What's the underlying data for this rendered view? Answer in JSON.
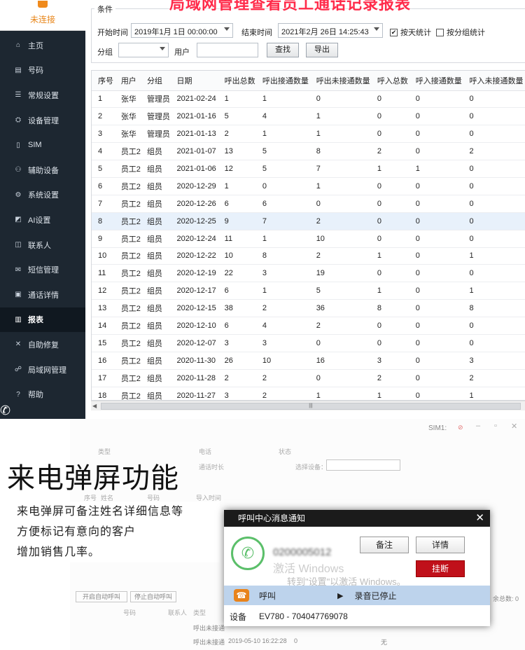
{
  "sidebar": {
    "status": "未连接",
    "items": [
      {
        "label": "主页",
        "icon": "home-icon"
      },
      {
        "label": "号码",
        "icon": "number-icon"
      },
      {
        "label": "常规设置",
        "icon": "settings-icon"
      },
      {
        "label": "设备管理",
        "icon": "device-icon"
      },
      {
        "label": "SIM",
        "icon": "sim-icon"
      },
      {
        "label": "辅助设备",
        "icon": "aux-device-icon"
      },
      {
        "label": "系统设置",
        "icon": "system-icon"
      },
      {
        "label": "AI设置",
        "icon": "ai-icon"
      },
      {
        "label": "联系人",
        "icon": "contacts-icon"
      },
      {
        "label": "短信管理",
        "icon": "sms-icon"
      },
      {
        "label": "通话详情",
        "icon": "call-detail-icon"
      },
      {
        "label": "报表",
        "icon": "report-icon"
      },
      {
        "label": "自助修复",
        "icon": "repair-icon"
      },
      {
        "label": "局域网管理",
        "icon": "lan-icon"
      },
      {
        "label": "帮助",
        "icon": "help-icon"
      }
    ],
    "active": "报表"
  },
  "banner": "局域网管理查看员工通话记录报表",
  "filters": {
    "legend": "条件",
    "start_label": "开始时间",
    "start_value": "2019年1月 1日 00:00:00",
    "end_label": "结束时间",
    "end_value": "2021年2月 26日 14:25:43",
    "by_day_label": "按天统计",
    "by_day_checked": true,
    "by_group_label": "按分组统计",
    "by_group_checked": false,
    "group_label": "分组",
    "group_value": "",
    "user_label": "用户",
    "user_value": "",
    "search_button": "查找",
    "export_button": "导出"
  },
  "table": {
    "columns": [
      "序号",
      "用户",
      "分组",
      "日期",
      "呼出总数",
      "呼出接通数量",
      "呼出未接通数量",
      "呼入总数",
      "呼入接通数量",
      "呼入未接通数量"
    ],
    "rows": [
      [
        "1",
        "张华",
        "管理员",
        "2021-02-24",
        "1",
        "1",
        "0",
        "0",
        "0",
        "0"
      ],
      [
        "2",
        "张华",
        "管理员",
        "2021-01-16",
        "5",
        "4",
        "1",
        "0",
        "0",
        "0"
      ],
      [
        "3",
        "张华",
        "管理员",
        "2021-01-13",
        "2",
        "1",
        "1",
        "0",
        "0",
        "0"
      ],
      [
        "4",
        "员工2",
        "组员",
        "2021-01-07",
        "13",
        "5",
        "8",
        "2",
        "0",
        "2"
      ],
      [
        "5",
        "员工2",
        "组员",
        "2021-01-06",
        "12",
        "5",
        "7",
        "1",
        "1",
        "0"
      ],
      [
        "6",
        "员工2",
        "组员",
        "2020-12-29",
        "1",
        "0",
        "1",
        "0",
        "0",
        "0"
      ],
      [
        "7",
        "员工2",
        "组员",
        "2020-12-26",
        "6",
        "6",
        "0",
        "0",
        "0",
        "0"
      ],
      [
        "8",
        "员工2",
        "组员",
        "2020-12-25",
        "9",
        "7",
        "2",
        "0",
        "0",
        "0"
      ],
      [
        "9",
        "员工2",
        "组员",
        "2020-12-24",
        "11",
        "1",
        "10",
        "0",
        "0",
        "0"
      ],
      [
        "10",
        "员工2",
        "组员",
        "2020-12-22",
        "10",
        "8",
        "2",
        "1",
        "0",
        "1"
      ],
      [
        "11",
        "员工2",
        "组员",
        "2020-12-19",
        "22",
        "3",
        "19",
        "0",
        "0",
        "0"
      ],
      [
        "12",
        "员工2",
        "组员",
        "2020-12-17",
        "6",
        "1",
        "5",
        "1",
        "0",
        "1"
      ],
      [
        "13",
        "员工2",
        "组员",
        "2020-12-15",
        "38",
        "2",
        "36",
        "8",
        "0",
        "8"
      ],
      [
        "14",
        "员工2",
        "组员",
        "2020-12-10",
        "6",
        "4",
        "2",
        "0",
        "0",
        "0"
      ],
      [
        "15",
        "员工2",
        "组员",
        "2020-12-07",
        "3",
        "3",
        "0",
        "0",
        "0",
        "0"
      ],
      [
        "16",
        "员工2",
        "组员",
        "2020-11-30",
        "26",
        "10",
        "16",
        "3",
        "0",
        "3"
      ],
      [
        "17",
        "员工2",
        "组员",
        "2020-11-28",
        "2",
        "2",
        "0",
        "2",
        "0",
        "2"
      ],
      [
        "18",
        "员工2",
        "组员",
        "2020-11-27",
        "3",
        "2",
        "1",
        "1",
        "0",
        "1"
      ]
    ],
    "selected_row": 8
  },
  "feature": {
    "title": "来电弹屏功能",
    "desc_lines": [
      "来电弹屏可备注姓名详细信息等",
      "方便标记有意向的客户",
      "增加销售几率。"
    ]
  },
  "background_window": {
    "sim_label": "SIM1:",
    "type_label": "类型",
    "phone_label": "电话",
    "state_label": "状态",
    "call_duration": "通话时长",
    "select_device": "选择设备：",
    "cols": [
      "序号",
      "姓名",
      "号码",
      "导入时间"
    ],
    "stop_auto_call": "停止自动呼叫",
    "start_auto_call": "开启自动呼叫",
    "list_cols": [
      "号码",
      "联系人",
      "类型"
    ],
    "total_label": "余总数: 0",
    "row1_type": "呼出未接通",
    "row2_type": "呼出未接通",
    "row2_time": "2019-05-10 16:22:28",
    "row2_dur": "0",
    "row2_flag": "无"
  },
  "popup": {
    "title": "呼叫中心消息通知",
    "caller_number": "0200005012",
    "note_button": "备注",
    "detail_button": "详情",
    "hangup_button": "挂断",
    "watermark_1": "激活 Windows",
    "watermark_2": "转到\"设置\"以激活 Windows。",
    "call_label": "呼叫",
    "record_status": "录音已停止",
    "device_label": "设备",
    "device_value": "EV780 - 704047769078"
  }
}
